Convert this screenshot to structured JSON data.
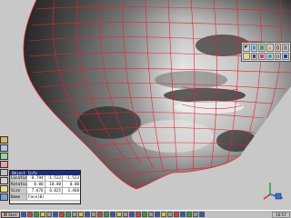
{
  "transform_panel": {
    "title": "Object Info",
    "rows": [
      {
        "label": "Location",
        "x": "-0.794",
        "y": "-1.523",
        "z": "-1.523"
      },
      {
        "label": "Rotation",
        "x": "0.00",
        "y": "18.00",
        "z": "0.00"
      },
      {
        "label": "Size",
        "x": "7.676",
        "y": "6.825",
        "z": "3.468"
      }
    ],
    "name_label": "Name",
    "name_value": "Face(0)"
  },
  "taskbar": {
    "start_label": "Start",
    "clock": "10:57"
  },
  "colors": {
    "wire": "#e8232b",
    "panel_title": "#1b2c7f",
    "background": "#c8c8c8"
  },
  "icons": {
    "left_toolbar": [
      "hand-icon",
      "move-icon",
      "rotate-icon",
      "scale-icon",
      "wire-icon",
      "camera-icon",
      "light-icon",
      "render-icon"
    ],
    "palette": [
      "arrow-icon",
      "sphere-icon",
      "cube-icon",
      "cone-icon",
      "torus-icon",
      "plane-icon",
      "lamp-icon",
      "camera-icon",
      "paint-icon",
      "globe-icon",
      "grid-icon",
      "text-icon"
    ]
  }
}
